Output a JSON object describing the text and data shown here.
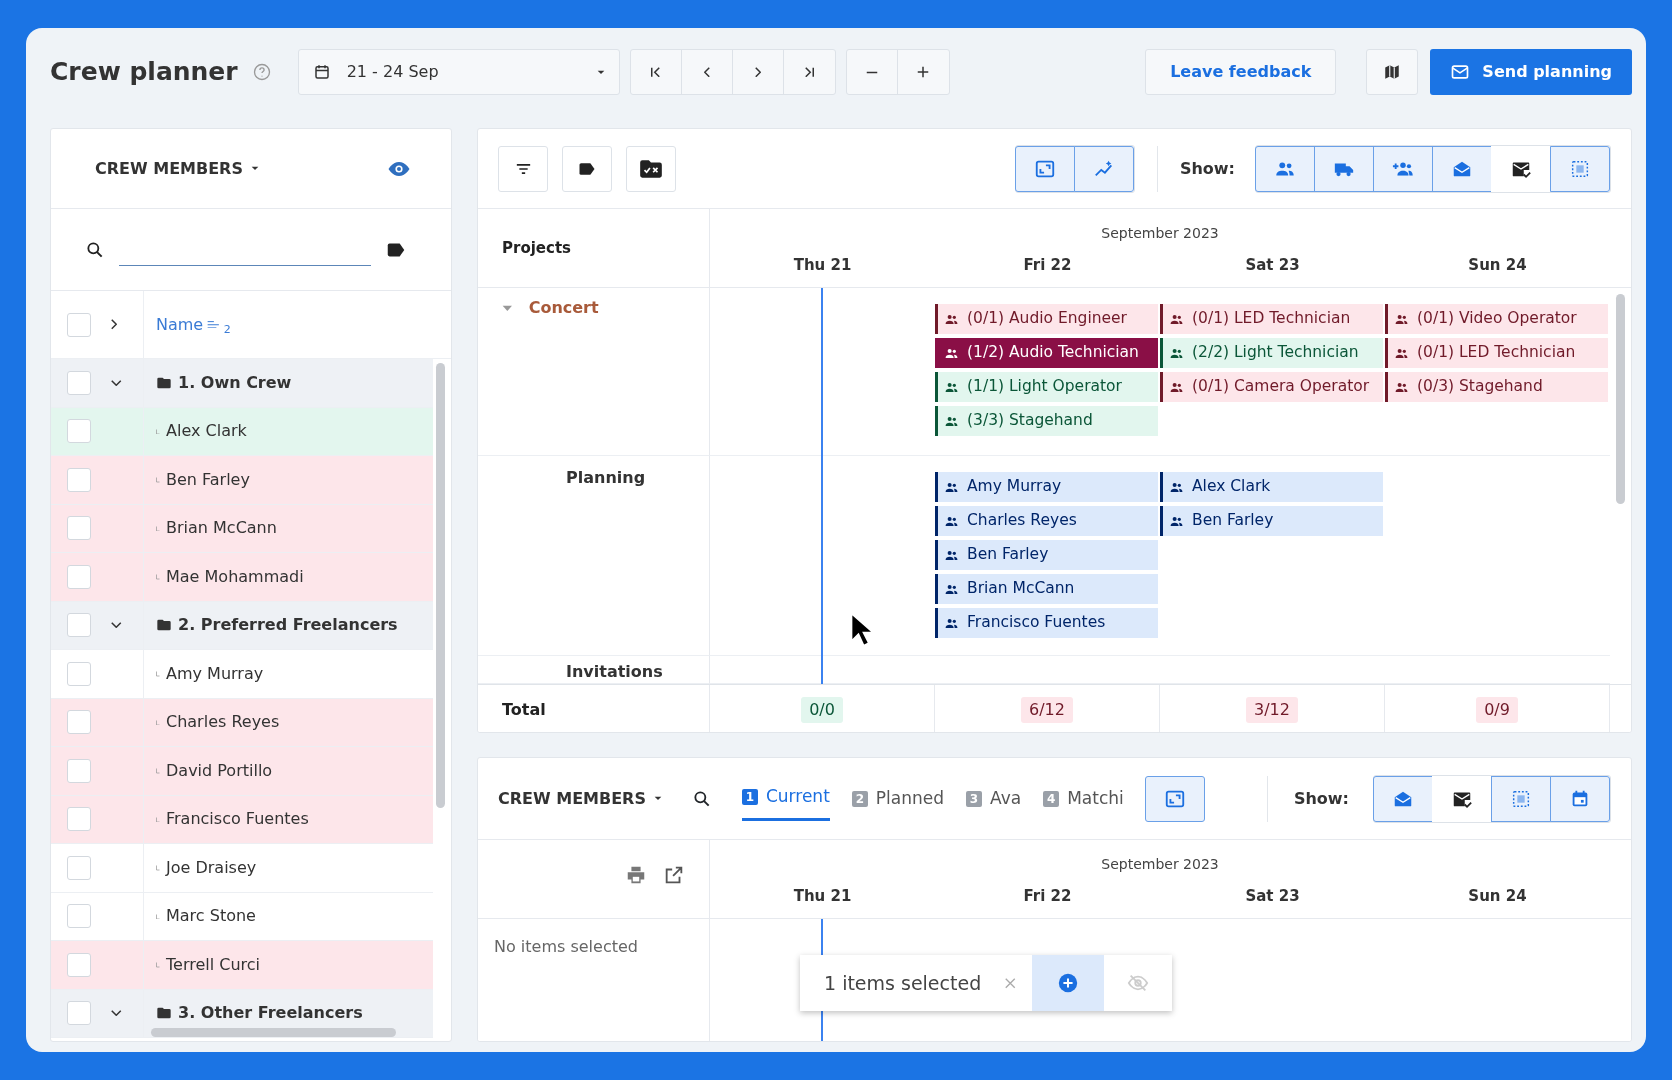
{
  "header": {
    "title": "Crew planner",
    "date_range": "21 - 24 Sep",
    "feedback_button": "Leave feedback",
    "send_button": "Send planning"
  },
  "crew_list": {
    "title": "CREW MEMBERS",
    "select_all_checked": false,
    "name_column": "Name",
    "sort_index": "2",
    "groups": [
      {
        "label": "1. Own Crew",
        "expanded": true,
        "checked": false,
        "members": [
          {
            "name": "Alex Clark",
            "color": "#e3f6ee",
            "checked": false
          },
          {
            "name": "Ben Farley",
            "color": "#fde6ea",
            "checked": false
          },
          {
            "name": "Brian McCann",
            "color": "#fde6ea",
            "checked": false
          },
          {
            "name": "Mae Mohammadi",
            "color": "#fde6ea",
            "checked": false
          }
        ]
      },
      {
        "label": "2. Preferred Freelancers",
        "expanded": true,
        "checked": false,
        "members": [
          {
            "name": "Amy Murray",
            "color": "#ffffff",
            "checked": false
          },
          {
            "name": "Charles Reyes",
            "color": "#fde6ea",
            "checked": false
          },
          {
            "name": "David Portillo",
            "color": "#fde6ea",
            "checked": false
          },
          {
            "name": "Francisco Fuentes",
            "color": "#fde6ea",
            "checked": false
          },
          {
            "name": "Joe Draisey",
            "color": "#ffffff",
            "checked": false
          },
          {
            "name": "Marc Stone",
            "color": "#ffffff",
            "checked": false
          },
          {
            "name": "Terrell Curci",
            "color": "#fde6ea",
            "checked": false
          }
        ]
      },
      {
        "label": "3. Other Freelancers",
        "expanded": true,
        "checked": false
      }
    ]
  },
  "planner": {
    "view_toggles": [
      {
        "kind": "expand",
        "on": true
      },
      {
        "kind": "chart",
        "on": true
      }
    ],
    "show_label": "Show:",
    "show_toggles": [
      {
        "kind": "people",
        "on": true
      },
      {
        "kind": "truck",
        "on": true
      },
      {
        "kind": "person-add",
        "on": true
      },
      {
        "kind": "envelope-open",
        "on": true
      },
      {
        "kind": "envelope-check",
        "on": false
      },
      {
        "kind": "selection",
        "on": true
      }
    ],
    "projects_heading": "Projects",
    "month": "September 2023",
    "days": [
      "Thu 21",
      "Fri 22",
      "Sat 23",
      "Sun 24"
    ],
    "sections": [
      {
        "label": "Concert",
        "kind": "project",
        "expanded": true,
        "columns": [
          {
            "kind": "empty"
          },
          {
            "kind": "tasks",
            "items": [
              {
                "label": "(0/1) Audio Engineer",
                "color": "#fde6ea",
                "selected": false
              },
              {
                "label": "(1/2) Audio Technician",
                "selected": true
              },
              {
                "label": "(1/1) Light Operator",
                "color": "#e2f6ee",
                "selected": false
              },
              {
                "label": "(3/3) Stagehand",
                "color": "#e2f6ee",
                "selected": false
              }
            ]
          },
          {
            "kind": "tasks",
            "items": [
              {
                "label": "(0/1) LED Technician",
                "color": "#fde6ea",
                "selected": false
              },
              {
                "label": "(2/2) Light Technician",
                "color": "#e2f6ee",
                "selected": false
              },
              {
                "label": "(0/1) Camera Operator",
                "color": "#fde6ea",
                "selected": false
              }
            ]
          },
          {
            "kind": "tasks",
            "items": [
              {
                "label": "(0/1) Video Operator",
                "color": "#fde6ea",
                "selected": false
              },
              {
                "label": "(0/1) LED Technician",
                "color": "#fde6ea",
                "selected": false
              },
              {
                "label": "(0/3) Stagehand",
                "color": "#fde6ea",
                "selected": false
              }
            ]
          }
        ]
      },
      {
        "label": "Planning",
        "kind": "planning",
        "columns": [
          {
            "kind": "empty"
          },
          {
            "kind": "tasks",
            "items": [
              {
                "label": "Amy Murray",
                "color": "#dce9fb",
                "selected": false
              },
              {
                "label": "Charles Reyes",
                "color": "#dce9fb",
                "selected": false
              },
              {
                "label": "Ben Farley",
                "color": "#dce9fb",
                "selected": false
              },
              {
                "label": "Brian McCann",
                "color": "#dce9fb",
                "selected": false
              },
              {
                "label": "Francisco Fuentes",
                "color": "#dce9fb",
                "selected": false
              }
            ]
          },
          {
            "kind": "tasks",
            "items": [
              {
                "label": "Alex Clark",
                "color": "#dce9fb",
                "selected": false
              },
              {
                "label": "Ben Farley",
                "color": "#dce9fb",
                "selected": false
              }
            ]
          },
          {
            "kind": "empty"
          }
        ]
      },
      {
        "label": "Invitations",
        "kind": "invitations"
      }
    ],
    "total_label": "Total",
    "totals": [
      {
        "text": "0/0",
        "color": "#e2f6ee"
      },
      {
        "text": "6/12",
        "color": "#fde6ea"
      },
      {
        "text": "3/12",
        "color": "#fde6ea"
      },
      {
        "text": "0/9",
        "color": "#fde6ea"
      }
    ]
  },
  "bottom_panel": {
    "title": "CREW MEMBERS",
    "tabs": [
      {
        "number": "1",
        "label": "Current",
        "selected": true
      },
      {
        "number": "2",
        "label": "Planned",
        "selected": false
      },
      {
        "number": "3",
        "label": "Ava",
        "selected": false
      },
      {
        "number": "4",
        "label": "Matchi",
        "selected": false
      }
    ],
    "expand_toggle": {
      "on": true
    },
    "show_label": "Show:",
    "show_toggles": [
      {
        "kind": "envelope-open",
        "on": true
      },
      {
        "kind": "envelope-check",
        "on": false
      },
      {
        "kind": "selection",
        "on": true
      },
      {
        "kind": "calendar",
        "on": true
      }
    ],
    "month": "September 2023",
    "days": [
      "Thu 21",
      "Fri 22",
      "Sat 23",
      "Sun 24"
    ],
    "empty_text": "No items selected",
    "selection_text": "1 items selected"
  }
}
